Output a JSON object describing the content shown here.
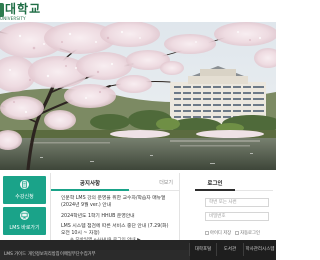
{
  "header": {
    "logo_title": "대학교",
    "logo_subtitle": "UNIVERSITY"
  },
  "quick_links": [
    {
      "label": "수강신청",
      "icon": "document-icon"
    },
    {
      "label": "LMS 바로가기",
      "icon": "monitor-icon"
    }
  ],
  "notice": {
    "title": "공지사항",
    "more": "더보기",
    "items": [
      "인문학 LMS 강의 운영을 위한 교수자/학습자 매뉴얼 (2024년 9월 ver.) 안내",
      "2024학년도 1학기 HHUB 운영안내",
      "LMS 시스템 점검에 따른 서비스 중단 안내 (7.29(화) 오전 10시 ~ 자정)"
    ],
    "ticker": "※ 모바일앱 e-HHUB 로그인 안내 ▶"
  },
  "login": {
    "title": "로그인",
    "id_placeholder": "학번 또는 사번",
    "pw_placeholder": "비밀번호",
    "checkboxes": [
      "아이디 저장",
      "자동로그인"
    ]
  },
  "footer": {
    "sub_links": [
      "LMS 가이드",
      "개인정보처리방침",
      "이메일무단수집거부"
    ],
    "site_buttons": [
      "대학포털",
      "도서관",
      "학사관리시스템"
    ]
  },
  "colors": {
    "accent": "#1aa389",
    "brand": "#1f6d45",
    "footer": "#262626"
  }
}
